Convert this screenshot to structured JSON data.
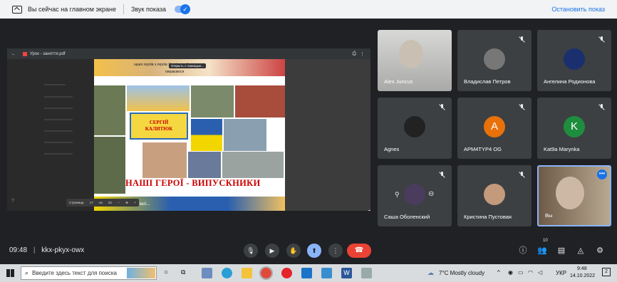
{
  "banner": {
    "presenting_text": "Вы сейчас на главном экране",
    "sound_label": "Звук показа",
    "stop_label": "Остановить показ"
  },
  "shared": {
    "tab_title": "Урок - заняття.pdf",
    "doc_top_text": "нших героїв з героїв України, чий",
    "doc_top_text2": "пишаємося",
    "popup_label": "Открыть с помощью...",
    "nameplate_line1": "СЕРГІЙ",
    "nameplate_line2": "КАЛИТЮК",
    "heroes_title": "НАШІ ГЕРОЇ - ВИПУСКНИКИ",
    "bottom_text": "А на мої...",
    "pager": {
      "label": "Страница",
      "current": "17",
      "of": "из",
      "total": "22",
      "minus": "−",
      "plus": "+"
    }
  },
  "participants": [
    {
      "name": "Alex Juncus",
      "type": "video"
    },
    {
      "name": "Владислав Петров",
      "type": "photo",
      "muted": true
    },
    {
      "name": "Ангелина Родионова",
      "type": "photo",
      "muted": true
    },
    {
      "name": "Agnes",
      "type": "photo",
      "muted": true
    },
    {
      "name": "APM4TYP4 OG",
      "type": "letter",
      "letter": "A",
      "color": "#e8710a",
      "muted": true
    },
    {
      "name": "Kat9a Marynka",
      "type": "letter",
      "letter": "K",
      "color": "#1e8e3e",
      "muted": true
    },
    {
      "name": "Саша Оболенский",
      "type": "photo",
      "muted": true
    },
    {
      "name": "Кристина Пустовая",
      "type": "photo",
      "muted": true
    },
    {
      "name": "Вы",
      "type": "self"
    }
  ],
  "controls": {
    "time": "09:48",
    "separator": "|",
    "meeting_code": "kkx-pkyx-owx",
    "participants_count": "10"
  },
  "taskbar": {
    "search_placeholder": "Введите здесь текст для поиска",
    "weather": "7°C  Mostly cloudy",
    "lang": "УКР",
    "clock_time": "9:48",
    "clock_date": "14.10.2022",
    "notif_count": "2"
  },
  "colors": {
    "accent": "#1a73e8",
    "hangup": "#ea4335",
    "tile_bg": "#3c4043",
    "page_bg": "#202124"
  }
}
